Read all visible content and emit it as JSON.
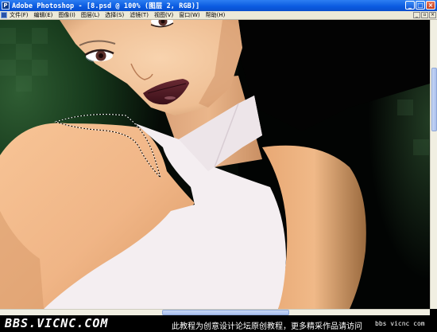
{
  "window": {
    "title": "Adobe Photoshop - [8.psd @ 100% (图层 2, RGB)]",
    "app_icon": "photoshop-icon",
    "controls": [
      "minimize-icon",
      "maximize-icon",
      "close-icon"
    ],
    "control_glyphs": {
      "minimize": "_",
      "maximize": "□",
      "close": "×"
    }
  },
  "menu": {
    "items": [
      "文件(F)",
      "编辑(E)",
      "图像(I)",
      "图层(L)",
      "选择(S)",
      "滤镜(T)",
      "视图(V)",
      "窗口(W)",
      "帮助(H)"
    ],
    "doc_controls": [
      "minimize-icon",
      "restore-icon",
      "close-icon"
    ],
    "doc_glyphs": {
      "minimize": "_",
      "restore": "▫",
      "close": "×"
    }
  },
  "colors": {
    "titlebar": "#0a5ae0",
    "menubar": "#ece9d8",
    "skin": "#f2b98c",
    "shirt": "#f4eef1",
    "background_green": "#1f4a24"
  },
  "footer": {
    "logo": "BBS.VICNC.COM",
    "note": "此教程为创意设计论坛原创教程，更多精采作品请访问",
    "url": "bbs vicnc com"
  }
}
